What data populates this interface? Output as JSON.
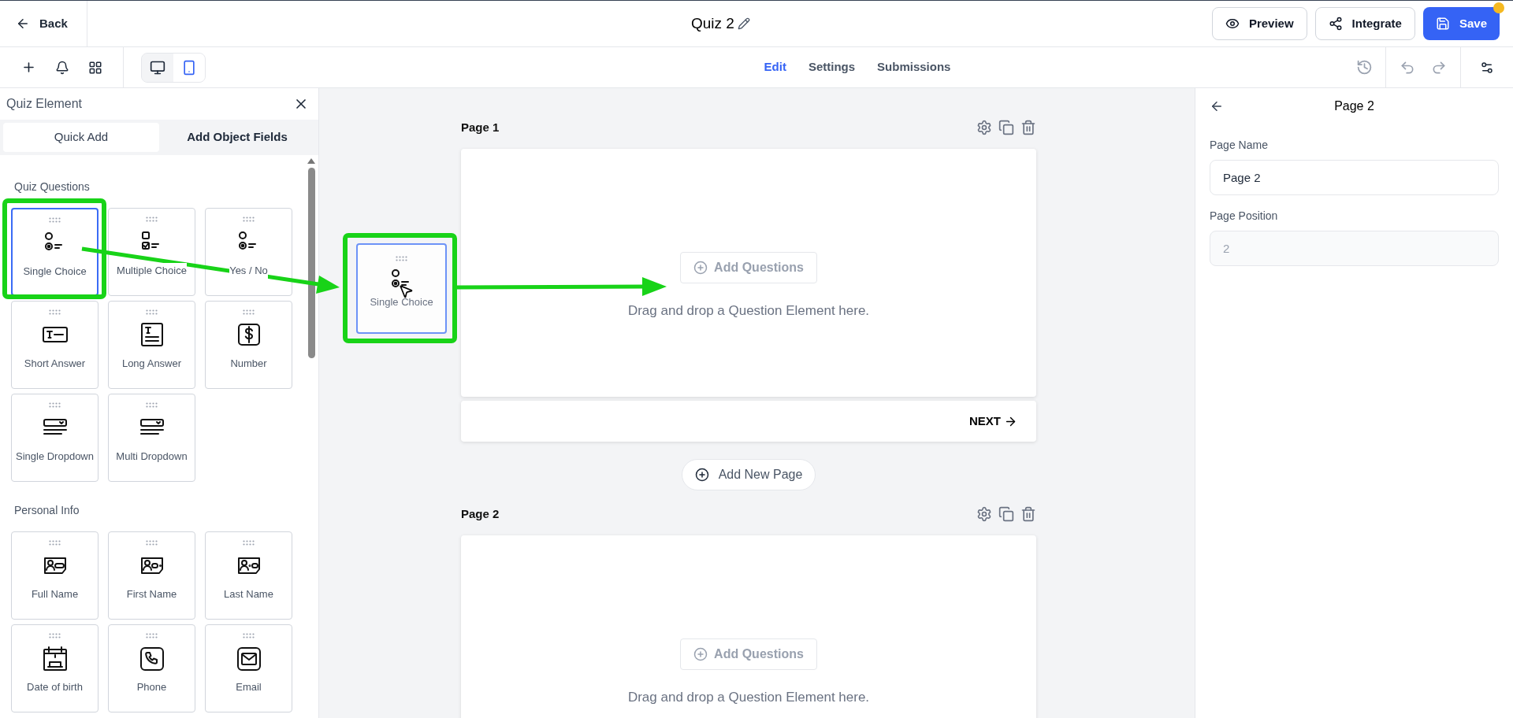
{
  "header": {
    "back": "Back",
    "title": "Quiz 2",
    "buttons": [
      {
        "kind": "preview",
        "label": "Preview",
        "dot": false
      },
      {
        "kind": "integrate",
        "label": "Integrate",
        "dot": false
      },
      {
        "kind": "save",
        "label": "Save",
        "dot": true
      }
    ]
  },
  "toolbar": {
    "devices": [
      {
        "kind": "desktop",
        "selected": false
      },
      {
        "kind": "mobile",
        "selected": true
      }
    ],
    "tabs": [
      {
        "label": "Edit",
        "selected": true
      },
      {
        "label": "Settings",
        "selected": false
      },
      {
        "label": "Submissions",
        "selected": false
      }
    ]
  },
  "panel": {
    "title": "Quiz Element",
    "tabs": [
      {
        "label": "Quick Add",
        "selected": true
      },
      {
        "label": "Add Object Fields",
        "selected": false
      }
    ],
    "sections": [
      {
        "title": "Quiz Questions",
        "items": [
          {
            "kind": "single",
            "label": "Single Choice",
            "selected": true
          },
          {
            "kind": "multiple",
            "label": "Multiple Choice",
            "selected": false
          },
          {
            "kind": "single",
            "label": "Yes / No",
            "selected": false
          },
          {
            "kind": "short",
            "label": "Short Answer",
            "selected": false
          },
          {
            "kind": "long",
            "label": "Long Answer",
            "selected": false
          },
          {
            "kind": "number",
            "label": "Number",
            "selected": false
          },
          {
            "kind": "dropdown",
            "label": "Single Dropdown",
            "selected": false
          },
          {
            "kind": "dropdown",
            "label": "Multi Dropdown",
            "selected": false
          }
        ]
      },
      {
        "title": "Personal Info",
        "items": [
          {
            "kind": "fullname",
            "label": "Full Name",
            "selected": false
          },
          {
            "kind": "firstname",
            "label": "First Name",
            "selected": false
          },
          {
            "kind": "lastname",
            "label": "Last Name",
            "selected": false
          },
          {
            "kind": "date",
            "label": "Date of birth",
            "selected": false
          },
          {
            "kind": "phone",
            "label": "Phone",
            "selected": false
          },
          {
            "kind": "email",
            "label": "Email",
            "selected": false
          }
        ]
      }
    ]
  },
  "drag_preview": {
    "kind": "single",
    "label": "Single Choice"
  },
  "pages": [
    {
      "title": "Page 1",
      "add_button": "Add Questions",
      "add_disabled": true,
      "hint": "Drag and drop a Question Element here.",
      "next": "NEXT"
    },
    {
      "title": "Page 2",
      "add_button": "Add Questions",
      "add_disabled": true,
      "hint": "Drag and drop a Question Element here."
    }
  ],
  "add_page": "Add New Page",
  "properties": {
    "title": "Page 2",
    "fields": [
      {
        "label": "Page Name",
        "value": "Page 2",
        "disabled": false
      },
      {
        "label": "Page Position",
        "value": "2",
        "disabled": true
      }
    ]
  }
}
